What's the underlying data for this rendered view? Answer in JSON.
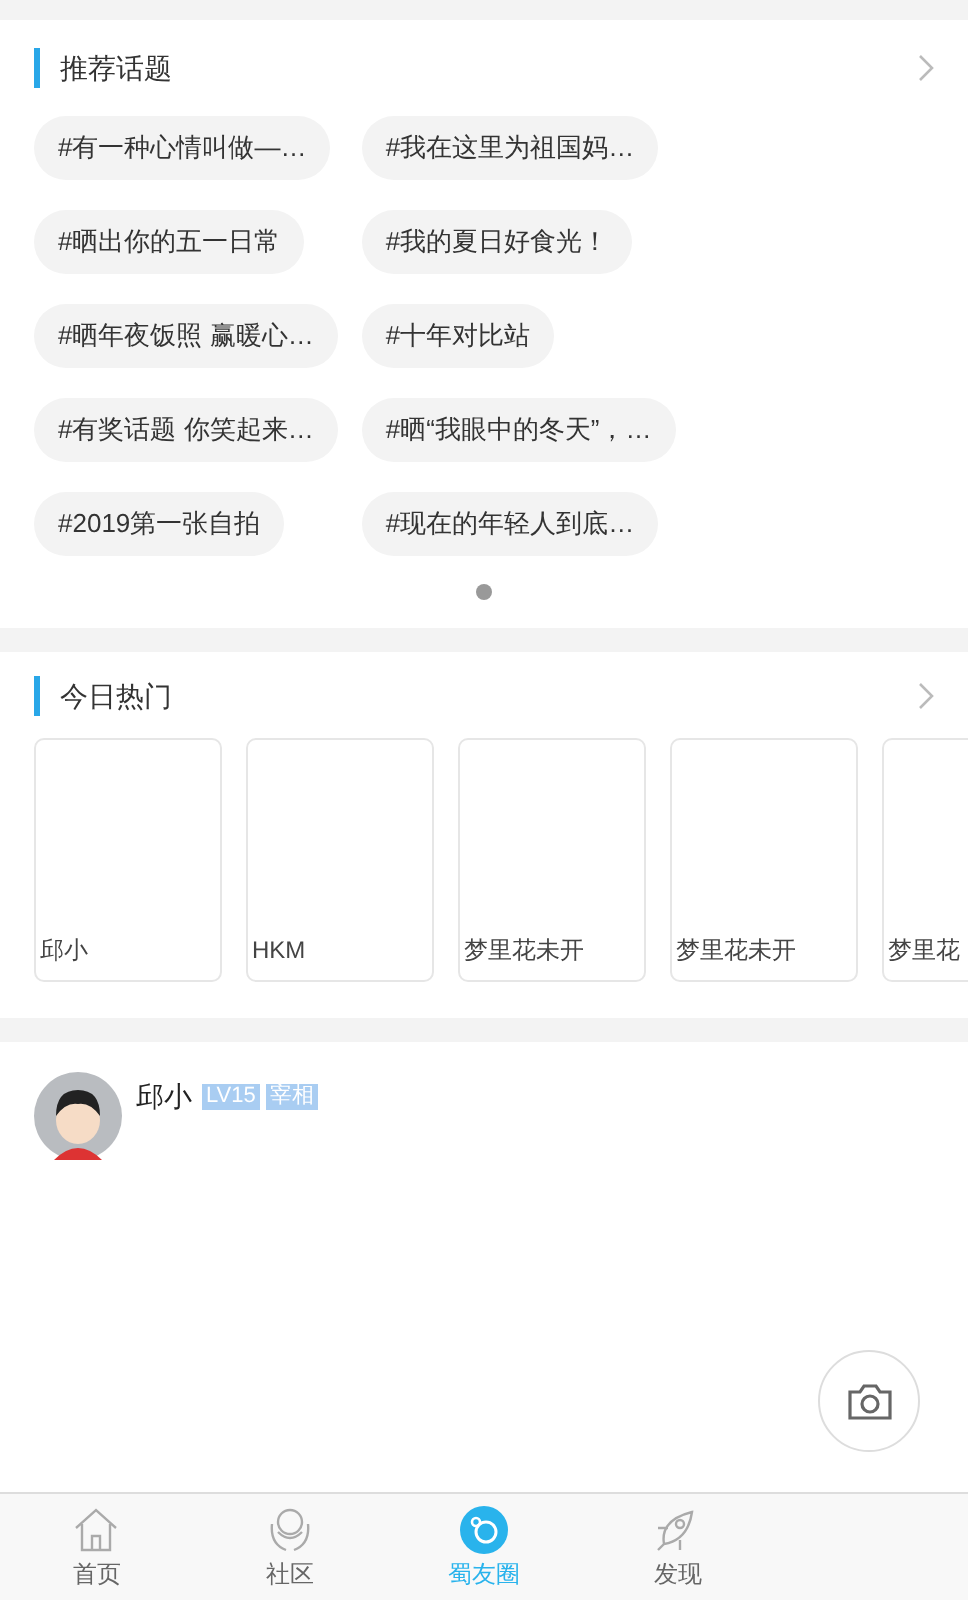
{
  "topics": {
    "title": "推荐话题",
    "chips": [
      "#有一种心情叫做—…",
      "#我在这里为祖国妈…",
      "#晒出你的五一日常",
      "#我的夏日好食光！",
      "#晒年夜饭照 赢暖心…",
      "#十年对比站",
      "#有奖话题 你笑起来…",
      "#晒“我眼中的冬天”，…",
      "#2019第一张自拍",
      "#现在的年轻人到底…"
    ],
    "pages": [
      {
        "selected": true
      }
    ]
  },
  "hot": {
    "title": "今日热门",
    "cards": [
      {
        "name": "邱小"
      },
      {
        "name": "HKM"
      },
      {
        "name": "梦里花未开"
      },
      {
        "name": "梦里花未开"
      },
      {
        "name": "梦里花"
      }
    ]
  },
  "post": {
    "author": "邱小",
    "badges": [
      "LV15",
      "宰相"
    ]
  },
  "tabs": [
    {
      "label": "首页",
      "kind": "home",
      "selected": false
    },
    {
      "label": "社区",
      "kind": "hands",
      "selected": false
    },
    {
      "label": "蜀友圈",
      "kind": "bubble",
      "selected": true
    },
    {
      "label": "发现",
      "kind": "rocket",
      "selected": false
    }
  ]
}
